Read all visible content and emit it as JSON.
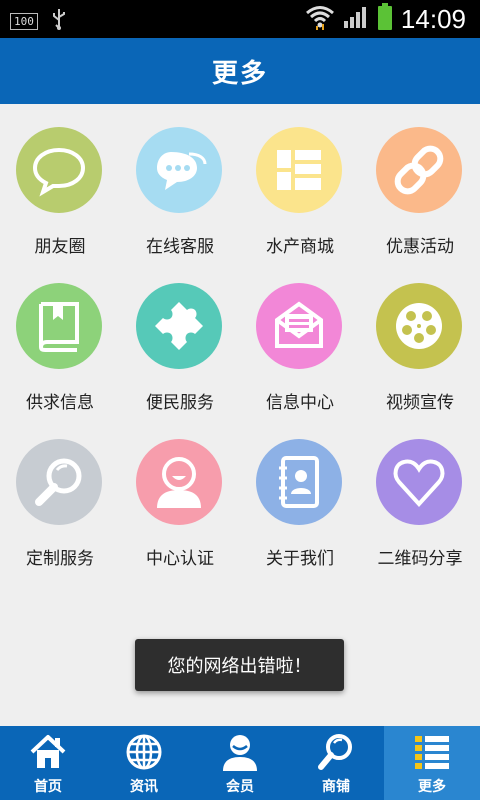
{
  "status_bar": {
    "battery_level_label": "100",
    "time": "14:09"
  },
  "header": {
    "title": "更多"
  },
  "grid": {
    "items": [
      {
        "label": "朋友圈",
        "icon": "chat-bubble-icon",
        "color": "#b8cc6e"
      },
      {
        "label": "在线客服",
        "icon": "chat-bubbles-icon",
        "color": "#a6dcf2"
      },
      {
        "label": "水产商城",
        "icon": "list-grid-icon",
        "color": "#fbe48c"
      },
      {
        "label": "优惠活动",
        "icon": "chain-link-icon",
        "color": "#fbb98a"
      },
      {
        "label": "供求信息",
        "icon": "book-icon",
        "color": "#8dd27a"
      },
      {
        "label": "便民服务",
        "icon": "puzzle-icon",
        "color": "#56c9b8"
      },
      {
        "label": "信息中心",
        "icon": "mail-icon",
        "color": "#f287d7"
      },
      {
        "label": "视频宣传",
        "icon": "film-reel-icon",
        "color": "#c4c24f"
      },
      {
        "label": "定制服务",
        "icon": "magnifier-icon",
        "color": "#c7ccd2"
      },
      {
        "label": "中心认证",
        "icon": "user-face-icon",
        "color": "#f79dac"
      },
      {
        "label": "关于我们",
        "icon": "contact-book-icon",
        "color": "#8db1e6"
      },
      {
        "label": "二维码分享",
        "icon": "heart-icon",
        "color": "#a68de6"
      }
    ]
  },
  "toast": {
    "message": "您的网络出错啦！"
  },
  "bottom_nav": {
    "items": [
      {
        "label": "首页",
        "icon": "home-icon",
        "active": false
      },
      {
        "label": "资讯",
        "icon": "globe-icon",
        "active": false
      },
      {
        "label": "会员",
        "icon": "member-icon",
        "active": false
      },
      {
        "label": "商铺",
        "icon": "search-icon",
        "active": false
      },
      {
        "label": "更多",
        "icon": "more-list-icon",
        "active": true
      }
    ]
  },
  "colors": {
    "header": "#0a66b7",
    "nav_active": "#2a86d0",
    "background": "#efefef"
  }
}
